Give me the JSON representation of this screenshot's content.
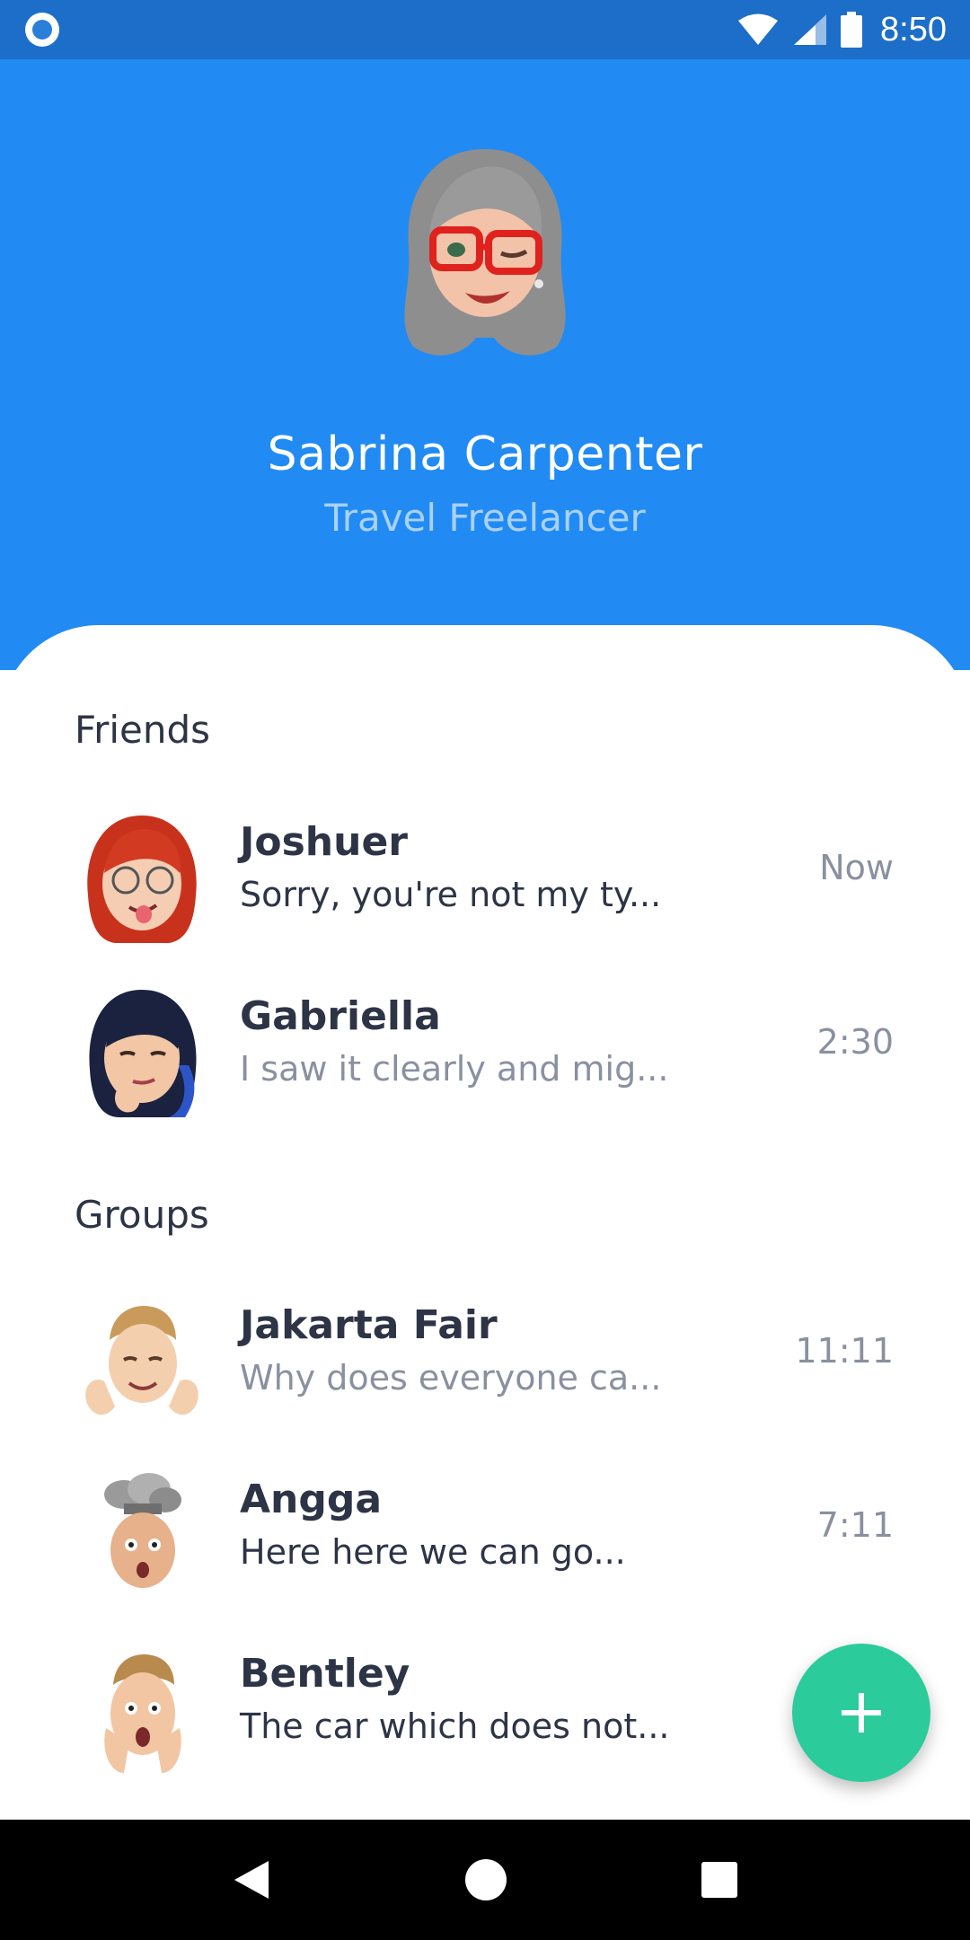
{
  "status_bar": {
    "time": "8:50",
    "icons": [
      "record-indicator-icon",
      "wifi-icon",
      "signal-icon",
      "battery-icon"
    ]
  },
  "profile": {
    "name": "Sabrina Carpenter",
    "role": "Travel Freelancer",
    "avatar": "memoji-gray-hair-red-glasses"
  },
  "sections": {
    "friends_title": "Friends",
    "groups_title": "Groups"
  },
  "friends": [
    {
      "name": "Joshuer",
      "preview": "Sorry, you're not my ty...",
      "time": "Now",
      "avatar": "memoji-red-hair-glasses"
    },
    {
      "name": "Gabriella",
      "preview": "I saw it clearly and mig...",
      "time": "2:30",
      "avatar": "memoji-dark-hair-thinking"
    }
  ],
  "groups": [
    {
      "name": "Jakarta Fair",
      "preview": "Why does everyone ca...",
      "time": "11:11",
      "avatar": "memoji-blond-hands-up"
    },
    {
      "name": "Angga",
      "preview": "Here here we can go...",
      "time": "7:11",
      "avatar": "memoji-mind-blown"
    },
    {
      "name": "Bentley",
      "preview": "The car which does not...",
      "time": "",
      "avatar": "memoji-shocked-hands-on-face"
    }
  ],
  "fab": {
    "icon": "plus-icon"
  },
  "nav_bar": {
    "icons": [
      "back-icon",
      "home-icon",
      "recents-icon"
    ]
  },
  "colors": {
    "header": "#218BF3",
    "status_bar": "#1C6EC8",
    "fab": "#2BCB9C",
    "text_dark": "#2D3446",
    "text_muted": "#8A90A0",
    "role_text": "#A9D1FA"
  }
}
